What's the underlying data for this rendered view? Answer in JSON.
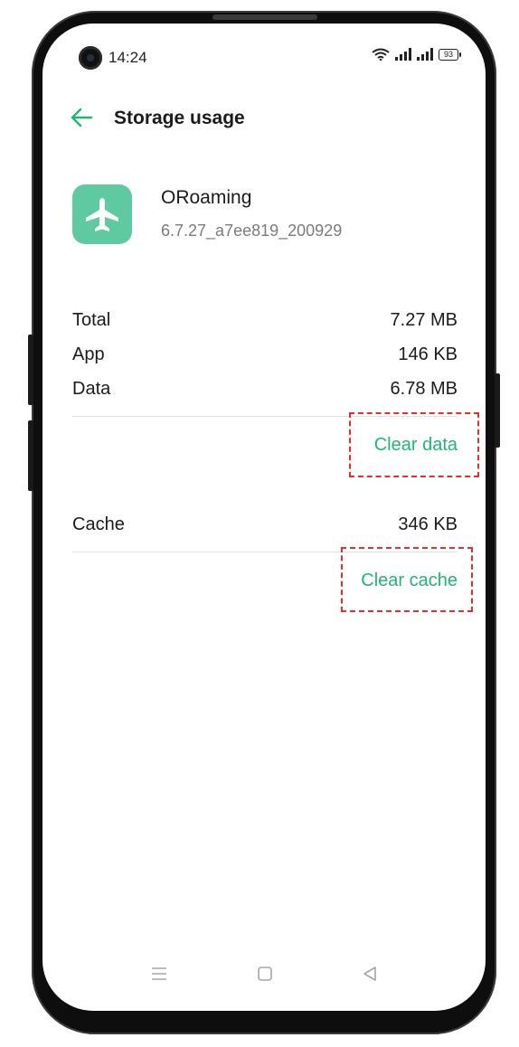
{
  "status_bar": {
    "time": "14:24",
    "battery": "93"
  },
  "header": {
    "title": "Storage usage"
  },
  "app": {
    "name": "ORoaming",
    "version": "6.7.27_a7ee819_200929"
  },
  "storage": {
    "rows": [
      {
        "label": "Total",
        "value": "7.27 MB"
      },
      {
        "label": "App",
        "value": "146 KB"
      },
      {
        "label": "Data",
        "value": "6.78 MB"
      }
    ],
    "clear_data_label": "Clear data"
  },
  "cache": {
    "label": "Cache",
    "value": "346 KB",
    "clear_cache_label": "Clear cache"
  },
  "colors": {
    "accent": "#22b573",
    "app_icon_bg": "#5fc9a2",
    "highlight": "#e03030"
  },
  "icons": {
    "back": "arrow-left-icon",
    "app": "airplane-icon",
    "wifi": "wifi-icon",
    "signal": "signal-icon",
    "battery": "battery-icon",
    "nav_menu": "menu-icon",
    "nav_home": "home-icon",
    "nav_back": "back-triangle-icon"
  }
}
